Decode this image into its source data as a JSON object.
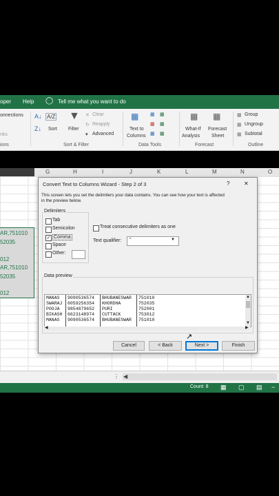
{
  "ribbon": {
    "tabs": [
      "oper",
      "Help"
    ],
    "tell_me": "Tell me what you want to do",
    "left_items": [
      "onnections",
      "nks"
    ],
    "left_group": "ions",
    "sort_az_label": "A/Z",
    "sort_label": "Sort",
    "filter_label": "Filter",
    "clear_label": "Clear",
    "reapply_label": "Reapply",
    "advanced_label": "Advanced",
    "sort_filter_group": "Sort & Filter",
    "text_to_columns": [
      "Text to",
      "Columns"
    ],
    "data_tools_group": "Data Tools",
    "whatif": [
      "What-If",
      "Analysis"
    ],
    "forecast_sheet": [
      "Forecast",
      "Sheet"
    ],
    "forecast_group": "Forecast",
    "group_label": "Group",
    "ungroup_label": "Ungroup",
    "subtotal_label": "Subtotal",
    "outline_group": "Outline"
  },
  "columns": [
    "G",
    "H",
    "I",
    "J",
    "K",
    "L",
    "M",
    "N",
    "O"
  ],
  "cells": [
    "AR,751010",
    "52035",
    "012",
    "AR,751010",
    "52035",
    "012"
  ],
  "status": {
    "count": "Count: 8"
  },
  "dialog": {
    "title": "Convert Text to Columns Wizard - Step 2 of 3",
    "help": "?",
    "close": "✕",
    "intro_line1": "This screen lets you set the delimiters your data contains.  You can see how your text is affected",
    "intro_line2": "in the preview below.",
    "delimiters_label": "Delimiters",
    "delimiters": [
      {
        "label": "Tab",
        "checked": false
      },
      {
        "label": "Semicolon",
        "checked": false
      },
      {
        "label": "Comma",
        "checked": true
      },
      {
        "label": "Space",
        "checked": false
      },
      {
        "label": "Other:",
        "checked": false
      }
    ],
    "consecutive_label": "Treat consecutive delimiters as one",
    "qualifier_label": "Text qualifier:",
    "qualifier_value": "\"",
    "preview_label": "Data preview",
    "preview_rows": [
      [
        "MANAS",
        "9090536574",
        "BHUBANESWAR",
        "751010"
      ],
      [
        "SWARAJ",
        "6059256354",
        "KHORDHA",
        "752035"
      ],
      [
        "POOJA",
        "9854879652",
        "PURI",
        "752001"
      ],
      [
        "BIKASH",
        "6623148974",
        "CUTTACK",
        "753012"
      ],
      [
        "MANAS",
        "9090536574",
        "BHUBANESWAR",
        "751010"
      ]
    ],
    "buttons": {
      "cancel": "Cancel",
      "back": "< Back",
      "next": "Next >",
      "finish": "Finish"
    }
  }
}
